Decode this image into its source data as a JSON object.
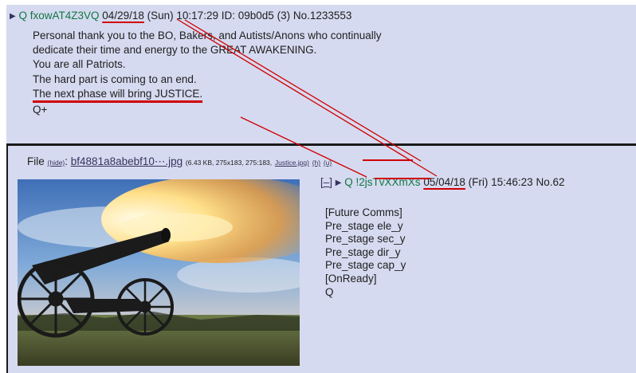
{
  "top_post": {
    "trip": "fxowAT4Z3VQ",
    "date": "04/29/18",
    "day": "(Sun)",
    "time": "10:17:29",
    "id_label": "ID:",
    "id_value": "09b0d5",
    "post_count": "(3)",
    "number": "No.1233553",
    "lines": [
      "Personal thank you to the BO, Bakers, and Autists/Anons who continually",
      "dedicate their time and energy to the GREAT AWAKENING.",
      "You are all Patriots.",
      "The hard part is coming to an end.",
      "The next phase will bring JUSTICE."
    ],
    "signature": "Q+"
  },
  "file_info": {
    "label": "File",
    "hide": "(hide)",
    "filename": "bf4881a8abebf10⋯.jpg",
    "meta": "(6.43 KB, 275x183, 275:183,",
    "source_link": "Justice.jpg)",
    "tool1": "(h)",
    "tool2": "(u)"
  },
  "reply_post": {
    "collapse": "[–]",
    "trip": "!2jsTvXXmXs",
    "date": "05/04/18",
    "day": "(Fri)",
    "time": "15:46:23",
    "number": "No.62",
    "lines": [
      "[Future Comms]",
      "Pre_stage ele_y",
      "Pre_stage sec_y",
      "Pre_stage dir_y",
      "Pre_stage cap_y",
      "[OnReady]",
      "Q"
    ]
  },
  "colors": {
    "post_bg": "#d6daf0",
    "tripcode": "#117743",
    "annotation": "#d00000"
  },
  "icons": [
    "triangle-arrow-icon",
    "cannon-image"
  ]
}
